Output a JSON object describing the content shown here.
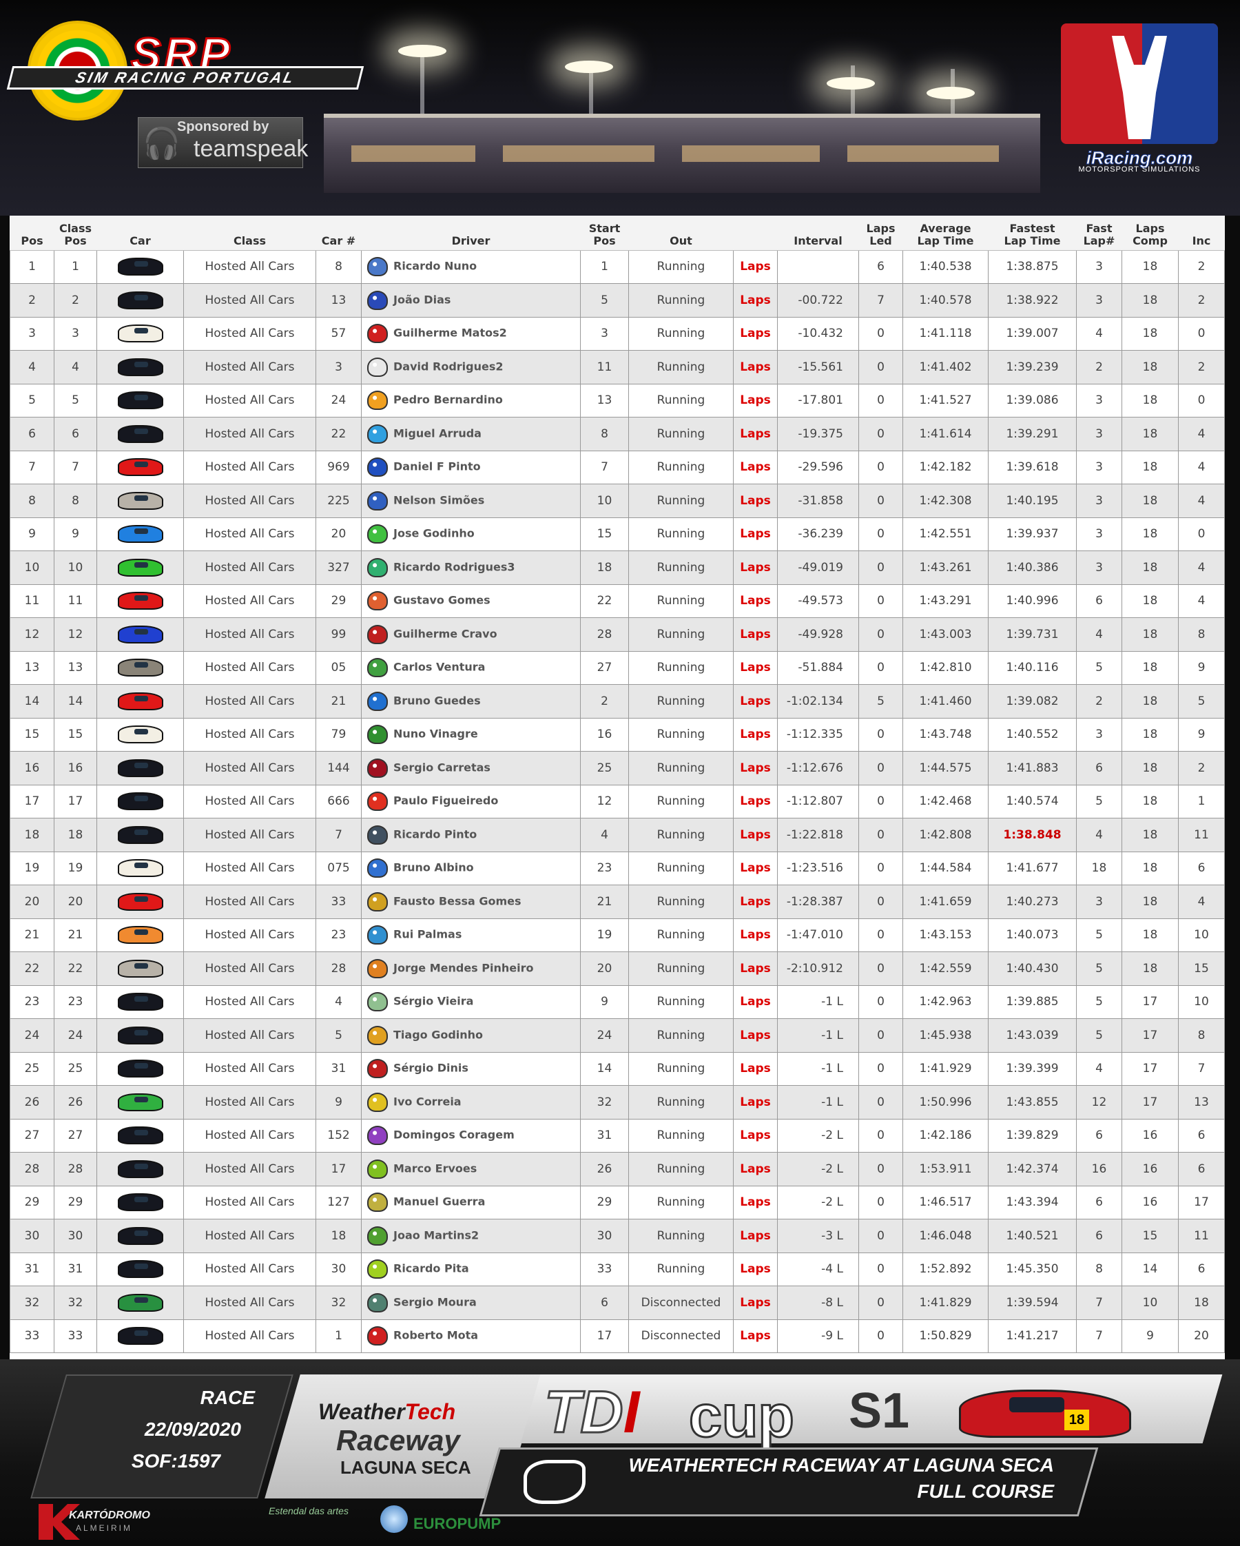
{
  "header": {
    "srp_title": "SRP",
    "srp_subtitle": "SIM RACING PORTUGAL",
    "sponsor_line1": "Sponsored by",
    "sponsor_line2": "teamspeak",
    "iracing_name": "iRacing.com",
    "iracing_sub": "MOTORSPORT SIMULATIONS"
  },
  "table": {
    "columns": [
      {
        "top": "",
        "bottom": "Pos"
      },
      {
        "top": "Class",
        "bottom": "Pos"
      },
      {
        "top": "",
        "bottom": "Car"
      },
      {
        "top": "",
        "bottom": "Class"
      },
      {
        "top": "",
        "bottom": "Car #"
      },
      {
        "top": "",
        "bottom": "Driver"
      },
      {
        "top": "Start",
        "bottom": "Pos"
      },
      {
        "top": "",
        "bottom": "Out"
      },
      {
        "top": "",
        "bottom": ""
      },
      {
        "top": "",
        "bottom": "Interval"
      },
      {
        "top": "Laps",
        "bottom": "Led"
      },
      {
        "top": "Average",
        "bottom": "Lap Time"
      },
      {
        "top": "Fastest",
        "bottom": "Lap Time"
      },
      {
        "top": "Fast",
        "bottom": "Lap#"
      },
      {
        "top": "Laps",
        "bottom": "Comp"
      },
      {
        "top": "",
        "bottom": "Inc"
      }
    ],
    "link_label": "Laps",
    "class_label": "Hosted All Cars",
    "rows": [
      {
        "pos": "1",
        "cpos": "1",
        "car_color": "#15171f",
        "num": "8",
        "driver": "Ricardo Nuno",
        "helmet": "#4a78c8",
        "start": "1",
        "out": "Running",
        "interval": "",
        "led": "6",
        "avg": "1:40.538",
        "fast": "1:38.875",
        "fastlap": "3",
        "comp": "18",
        "inc": "2"
      },
      {
        "pos": "2",
        "cpos": "2",
        "car_color": "#15171f",
        "num": "13",
        "driver": "João Dias",
        "helmet": "#2a4ab8",
        "start": "5",
        "out": "Running",
        "interval": "-00.722",
        "led": "7",
        "avg": "1:40.578",
        "fast": "1:38.922",
        "fastlap": "3",
        "comp": "18",
        "inc": "2"
      },
      {
        "pos": "3",
        "cpos": "3",
        "car_color": "#f3efe4",
        "num": "57",
        "driver": "Guilherme Matos2",
        "helmet": "#d02020",
        "start": "3",
        "out": "Running",
        "interval": "-10.432",
        "led": "0",
        "avg": "1:41.118",
        "fast": "1:39.007",
        "fastlap": "4",
        "comp": "18",
        "inc": "0"
      },
      {
        "pos": "4",
        "cpos": "4",
        "car_color": "#15171f",
        "num": "3",
        "driver": "David Rodrigues2",
        "helmet": "#e8e8e8",
        "start": "11",
        "out": "Running",
        "interval": "-15.561",
        "led": "0",
        "avg": "1:41.402",
        "fast": "1:39.239",
        "fastlap": "2",
        "comp": "18",
        "inc": "2"
      },
      {
        "pos": "5",
        "cpos": "5",
        "car_color": "#15171f",
        "num": "24",
        "driver": "Pedro Bernardino",
        "helmet": "#f0a020",
        "start": "13",
        "out": "Running",
        "interval": "-17.801",
        "led": "0",
        "avg": "1:41.527",
        "fast": "1:39.086",
        "fastlap": "3",
        "comp": "18",
        "inc": "0"
      },
      {
        "pos": "6",
        "cpos": "6",
        "car_color": "#15171f",
        "num": "22",
        "driver": "Miguel Arruda",
        "helmet": "#30a0e0",
        "start": "8",
        "out": "Running",
        "interval": "-19.375",
        "led": "0",
        "avg": "1:41.614",
        "fast": "1:39.291",
        "fastlap": "3",
        "comp": "18",
        "inc": "4"
      },
      {
        "pos": "7",
        "cpos": "7",
        "car_color": "#e01818",
        "num": "969",
        "driver": "Daniel F Pinto",
        "helmet": "#2050c0",
        "start": "7",
        "out": "Running",
        "interval": "-29.596",
        "led": "0",
        "avg": "1:42.182",
        "fast": "1:39.618",
        "fastlap": "3",
        "comp": "18",
        "inc": "4"
      },
      {
        "pos": "8",
        "cpos": "8",
        "car_color": "#b8b2a8",
        "num": "225",
        "driver": "Nelson Simões",
        "helmet": "#3060c0",
        "start": "10",
        "out": "Running",
        "interval": "-31.858",
        "led": "0",
        "avg": "1:42.308",
        "fast": "1:40.195",
        "fastlap": "3",
        "comp": "18",
        "inc": "4"
      },
      {
        "pos": "9",
        "cpos": "9",
        "car_color": "#2080e0",
        "num": "20",
        "driver": "Jose Godinho",
        "helmet": "#40c040",
        "start": "15",
        "out": "Running",
        "interval": "-36.239",
        "led": "0",
        "avg": "1:42.551",
        "fast": "1:39.937",
        "fastlap": "3",
        "comp": "18",
        "inc": "0"
      },
      {
        "pos": "10",
        "cpos": "10",
        "car_color": "#30c030",
        "num": "327",
        "driver": "Ricardo Rodrigues3",
        "helmet": "#30b070",
        "start": "18",
        "out": "Running",
        "interval": "-49.019",
        "led": "0",
        "avg": "1:43.261",
        "fast": "1:40.386",
        "fastlap": "3",
        "comp": "18",
        "inc": "4"
      },
      {
        "pos": "11",
        "cpos": "11",
        "car_color": "#e01818",
        "num": "29",
        "driver": "Gustavo Gomes",
        "helmet": "#e06030",
        "start": "22",
        "out": "Running",
        "interval": "-49.573",
        "led": "0",
        "avg": "1:43.291",
        "fast": "1:40.996",
        "fastlap": "6",
        "comp": "18",
        "inc": "4"
      },
      {
        "pos": "12",
        "cpos": "12",
        "car_color": "#2040d0",
        "num": "99",
        "driver": "Guilherme Cravo",
        "helmet": "#c02020",
        "start": "28",
        "out": "Running",
        "interval": "-49.928",
        "led": "0",
        "avg": "1:43.003",
        "fast": "1:39.731",
        "fastlap": "4",
        "comp": "18",
        "inc": "8"
      },
      {
        "pos": "13",
        "cpos": "13",
        "car_color": "#8a8478",
        "num": "05",
        "driver": "Carlos Ventura",
        "helmet": "#40a040",
        "start": "27",
        "out": "Running",
        "interval": "-51.884",
        "led": "0",
        "avg": "1:42.810",
        "fast": "1:40.116",
        "fastlap": "5",
        "comp": "18",
        "inc": "9"
      },
      {
        "pos": "14",
        "cpos": "14",
        "car_color": "#e01818",
        "num": "21",
        "driver": "Bruno Guedes",
        "helmet": "#2070d0",
        "start": "2",
        "out": "Running",
        "interval": "-1:02.134",
        "led": "5",
        "avg": "1:41.460",
        "fast": "1:39.082",
        "fastlap": "2",
        "comp": "18",
        "inc": "5"
      },
      {
        "pos": "15",
        "cpos": "15",
        "car_color": "#f3efe4",
        "num": "79",
        "driver": "Nuno Vinagre",
        "helmet": "#309030",
        "start": "16",
        "out": "Running",
        "interval": "-1:12.335",
        "led": "0",
        "avg": "1:43.748",
        "fast": "1:40.552",
        "fastlap": "3",
        "comp": "18",
        "inc": "9"
      },
      {
        "pos": "16",
        "cpos": "16",
        "car_color": "#15171f",
        "num": "144",
        "driver": "Sergio Carretas",
        "helmet": "#a01020",
        "start": "25",
        "out": "Running",
        "interval": "-1:12.676",
        "led": "0",
        "avg": "1:44.575",
        "fast": "1:41.883",
        "fastlap": "6",
        "comp": "18",
        "inc": "2"
      },
      {
        "pos": "17",
        "cpos": "17",
        "car_color": "#15171f",
        "num": "666",
        "driver": "Paulo Figueiredo",
        "helmet": "#e03020",
        "start": "12",
        "out": "Running",
        "interval": "-1:12.807",
        "led": "0",
        "avg": "1:42.468",
        "fast": "1:40.574",
        "fastlap": "5",
        "comp": "18",
        "inc": "1"
      },
      {
        "pos": "18",
        "cpos": "18",
        "car_color": "#15171f",
        "num": "7",
        "driver": "Ricardo Pinto",
        "helmet": "#405060",
        "start": "4",
        "out": "Running",
        "interval": "-1:22.818",
        "led": "0",
        "avg": "1:42.808",
        "fast": "1:38.848",
        "fast_best": true,
        "fastlap": "4",
        "comp": "18",
        "inc": "11"
      },
      {
        "pos": "19",
        "cpos": "19",
        "car_color": "#f3efe4",
        "num": "075",
        "driver": "Bruno Albino",
        "helmet": "#3070d0",
        "start": "23",
        "out": "Running",
        "interval": "-1:23.516",
        "led": "0",
        "avg": "1:44.584",
        "fast": "1:41.677",
        "fastlap": "18",
        "comp": "18",
        "inc": "6"
      },
      {
        "pos": "20",
        "cpos": "20",
        "car_color": "#e01818",
        "num": "33",
        "driver": "Fausto Bessa Gomes",
        "helmet": "#d0a020",
        "start": "21",
        "out": "Running",
        "interval": "-1:28.387",
        "led": "0",
        "avg": "1:41.659",
        "fast": "1:40.273",
        "fastlap": "3",
        "comp": "18",
        "inc": "4"
      },
      {
        "pos": "21",
        "cpos": "21",
        "car_color": "#f08a30",
        "num": "23",
        "driver": "Rui Palmas",
        "helmet": "#3090d0",
        "start": "19",
        "out": "Running",
        "interval": "-1:47.010",
        "led": "0",
        "avg": "1:43.153",
        "fast": "1:40.073",
        "fastlap": "5",
        "comp": "18",
        "inc": "10"
      },
      {
        "pos": "22",
        "cpos": "22",
        "car_color": "#b8b2a8",
        "num": "28",
        "driver": "Jorge Mendes Pinheiro",
        "helmet": "#e08020",
        "start": "20",
        "out": "Running",
        "interval": "-2:10.912",
        "led": "0",
        "avg": "1:42.559",
        "fast": "1:40.430",
        "fastlap": "5",
        "comp": "18",
        "inc": "15"
      },
      {
        "pos": "23",
        "cpos": "23",
        "car_color": "#15171f",
        "num": "4",
        "driver": "Sérgio Vieira",
        "helmet": "#90c090",
        "start": "9",
        "out": "Running",
        "interval": "-1 L",
        "led": "0",
        "avg": "1:42.963",
        "fast": "1:39.885",
        "fastlap": "5",
        "comp": "17",
        "inc": "10"
      },
      {
        "pos": "24",
        "cpos": "24",
        "car_color": "#15171f",
        "num": "5",
        "driver": "Tiago Godinho",
        "helmet": "#e0a020",
        "start": "24",
        "out": "Running",
        "interval": "-1 L",
        "led": "0",
        "avg": "1:45.938",
        "fast": "1:43.039",
        "fastlap": "5",
        "comp": "17",
        "inc": "8"
      },
      {
        "pos": "25",
        "cpos": "25",
        "car_color": "#15171f",
        "num": "31",
        "driver": "Sérgio Dinis",
        "helmet": "#c02020",
        "start": "14",
        "out": "Running",
        "interval": "-1 L",
        "led": "0",
        "avg": "1:41.929",
        "fast": "1:39.399",
        "fastlap": "4",
        "comp": "17",
        "inc": "7"
      },
      {
        "pos": "26",
        "cpos": "26",
        "car_color": "#30b040",
        "num": "9",
        "driver": "Ivo Correia",
        "helmet": "#e0c020",
        "start": "32",
        "out": "Running",
        "interval": "-1 L",
        "led": "0",
        "avg": "1:50.996",
        "fast": "1:43.855",
        "fastlap": "12",
        "comp": "17",
        "inc": "13"
      },
      {
        "pos": "27",
        "cpos": "27",
        "car_color": "#15171f",
        "num": "152",
        "driver": "Domingos Coragem",
        "helmet": "#9040c0",
        "start": "31",
        "out": "Running",
        "interval": "-2 L",
        "led": "0",
        "avg": "1:42.186",
        "fast": "1:39.829",
        "fastlap": "6",
        "comp": "16",
        "inc": "6"
      },
      {
        "pos": "28",
        "cpos": "28",
        "car_color": "#15171f",
        "num": "17",
        "driver": "Marco Ervoes",
        "helmet": "#80c020",
        "start": "26",
        "out": "Running",
        "interval": "-2 L",
        "led": "0",
        "avg": "1:53.911",
        "fast": "1:42.374",
        "fastlap": "16",
        "comp": "16",
        "inc": "6"
      },
      {
        "pos": "29",
        "cpos": "29",
        "car_color": "#15171f",
        "num": "127",
        "driver": "Manuel Guerra",
        "helmet": "#c0b040",
        "start": "29",
        "out": "Running",
        "interval": "-2 L",
        "led": "0",
        "avg": "1:46.517",
        "fast": "1:43.394",
        "fastlap": "6",
        "comp": "16",
        "inc": "17"
      },
      {
        "pos": "30",
        "cpos": "30",
        "car_color": "#15171f",
        "num": "18",
        "driver": "Joao Martins2",
        "helmet": "#50a030",
        "start": "30",
        "out": "Running",
        "interval": "-3 L",
        "led": "0",
        "avg": "1:46.048",
        "fast": "1:40.521",
        "fastlap": "6",
        "comp": "15",
        "inc": "11"
      },
      {
        "pos": "31",
        "cpos": "31",
        "car_color": "#15171f",
        "num": "30",
        "driver": "Ricardo Pita",
        "helmet": "#a0d020",
        "start": "33",
        "out": "Running",
        "interval": "-4 L",
        "led": "0",
        "avg": "1:52.892",
        "fast": "1:45.350",
        "fastlap": "8",
        "comp": "14",
        "inc": "6"
      },
      {
        "pos": "32",
        "cpos": "32",
        "car_color": "#289040",
        "num": "32",
        "driver": "Sergio Moura",
        "helmet": "#508070",
        "start": "6",
        "out": "Disconnected",
        "interval": "-8 L",
        "led": "0",
        "avg": "1:41.829",
        "fast": "1:39.594",
        "fastlap": "7",
        "comp": "10",
        "inc": "18"
      },
      {
        "pos": "33",
        "cpos": "33",
        "car_color": "#15171f",
        "num": "1",
        "driver": "Roberto Mota",
        "helmet": "#d02020",
        "start": "17",
        "out": "Disconnected",
        "interval": "-9 L",
        "led": "0",
        "avg": "1:50.829",
        "fast": "1:41.217",
        "fastlap": "7",
        "comp": "9",
        "inc": "20"
      }
    ]
  },
  "footer": {
    "session": "RACE",
    "date": "22/09/2020",
    "sof": "SOF:1597",
    "wt_line1a": "Weather",
    "wt_line1b": "Tech",
    "wt_line2": "Raceway",
    "wt_line3": "LAGUNA SECA",
    "tdi_a": "TD",
    "tdi_b": "I",
    "cup": "cup",
    "season": "S1",
    "car_number": "18",
    "track_line1": "WEATHERTECH RACEWAY AT LAGUNA SECA",
    "track_line2": "FULL COURSE",
    "kart_name": "KARTÓDROMO",
    "kart_sub": "ALMEIRIM",
    "estendal": "Estendal das artes",
    "europump": "EUROPUMP"
  }
}
